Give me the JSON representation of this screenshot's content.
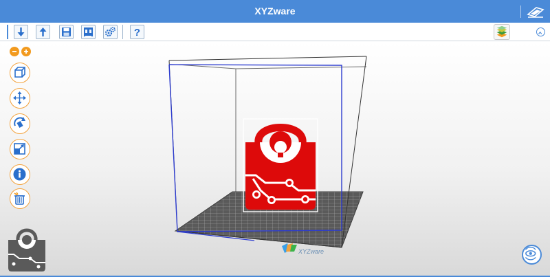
{
  "app": {
    "title": "XYZware",
    "brand_color": "#4a8ad8",
    "accent_color": "#f3a23c",
    "model_color": "#dd0a0a"
  },
  "toolbar": {
    "buttons": [
      {
        "name": "import",
        "icon": "download-arrow-icon"
      },
      {
        "name": "export",
        "icon": "upload-arrow-icon"
      },
      {
        "name": "save",
        "icon": "floppy-disk-icon"
      },
      {
        "name": "printer",
        "icon": "printer-icon"
      },
      {
        "name": "settings",
        "icon": "gears-icon"
      },
      {
        "name": "help",
        "icon": "question-mark-icon",
        "label": "?"
      }
    ],
    "right": [
      {
        "name": "layers",
        "icon": "layers-icon"
      },
      {
        "name": "collapse",
        "icon": "chevron-up-icon"
      }
    ]
  },
  "sidebar": {
    "zoom": [
      "minus-icon",
      "plus-icon"
    ],
    "tools": [
      {
        "name": "view",
        "icon": "cube-icon"
      },
      {
        "name": "move",
        "icon": "move-arrows-icon"
      },
      {
        "name": "rotate",
        "icon": "rotate-icon"
      },
      {
        "name": "scale",
        "icon": "scale-icon"
      },
      {
        "name": "info",
        "icon": "info-icon"
      },
      {
        "name": "delete",
        "icon": "trash-icon"
      }
    ]
  },
  "viewport": {
    "bed_brand": "XYZware",
    "bottom_right_button": "view-reset-icon"
  }
}
